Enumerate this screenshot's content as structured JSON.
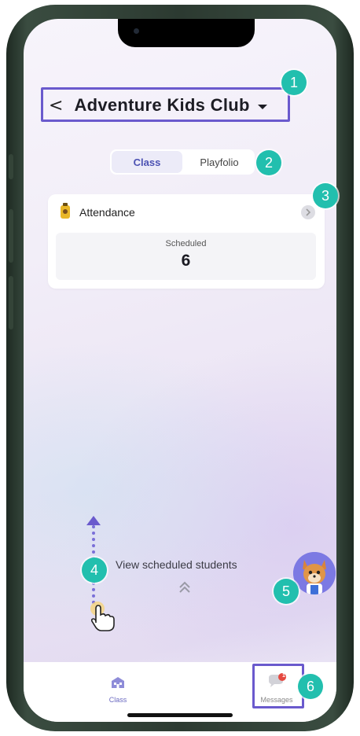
{
  "header": {
    "back_glyph": "<",
    "title": "Adventure Kids Club"
  },
  "segment": {
    "tabs": [
      {
        "label": "Class",
        "active": true
      },
      {
        "label": "Playfolio",
        "active": false
      }
    ]
  },
  "attendance_card": {
    "title": "Attendance",
    "stat_label": "Scheduled",
    "stat_value": "6"
  },
  "swipe_hint": {
    "text": "View scheduled students",
    "chevrons": "^"
  },
  "tab_bar": {
    "items": [
      {
        "label": "Class",
        "icon": "school-icon"
      },
      {
        "label": "Messages",
        "icon": "chat-bubble-icon",
        "badge": "1"
      }
    ]
  },
  "annotations": [
    "1",
    "2",
    "3",
    "4",
    "5",
    "6"
  ],
  "colors": {
    "accent": "#6a5acd",
    "badge_teal": "#22bfae",
    "notification_red": "#e5483f",
    "active_tab_text": "#4c52b3"
  }
}
